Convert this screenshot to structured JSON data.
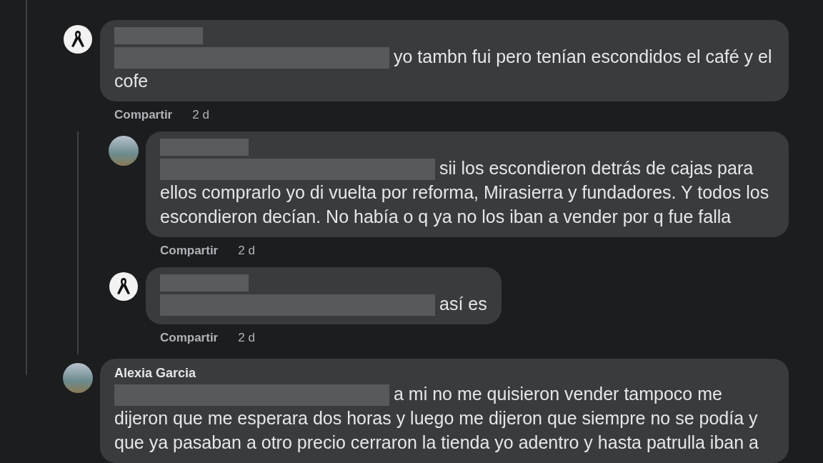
{
  "comments": [
    {
      "kind": "ribbon",
      "text": "yo tambn fui pero tenían escondidos el café y el cofe",
      "share": "Compartir",
      "time": "2 d",
      "children": [
        {
          "kind": "photo",
          "text": "sii los escondieron detrás de cajas para ellos comprarlo yo di vuelta por reforma, Mirasierra y fundadores. Y todos los escondieron decían. No había o q ya no los iban a vender por q fue falla",
          "share": "Compartir",
          "time": "2 d"
        },
        {
          "kind": "ribbon",
          "text": "así es",
          "share": "Compartir",
          "time": "2 d"
        }
      ]
    },
    {
      "kind": "photo",
      "author": "Alexia Garcia",
      "text": "a mi no me quisieron vender tampoco me dijeron que me esperara dos horas y luego me dijeron que siempre no se podía y que ya pasaban a otro precio cerraron la tienda yo adentro y hasta patrulla iban a"
    }
  ]
}
